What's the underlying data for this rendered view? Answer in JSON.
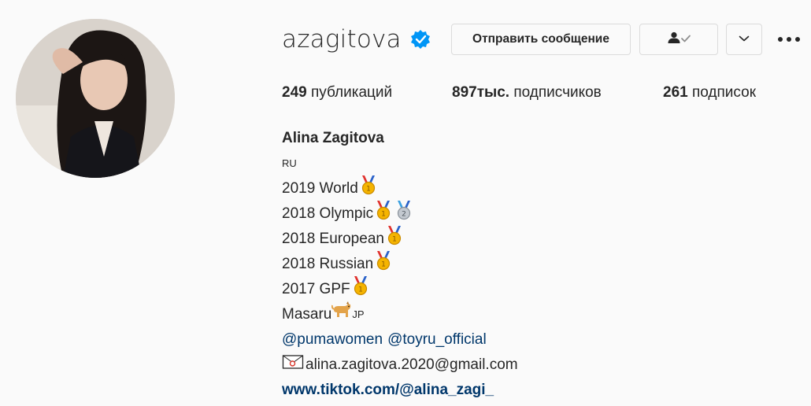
{
  "profile": {
    "username": "azagitova",
    "verified_icon": "verified-badge-icon",
    "message_button": "Отправить сообщение",
    "follow_icon": "person-check-icon",
    "suggest_icon": "chevron-down-icon",
    "more_icon": "more-dots-icon"
  },
  "stats": {
    "posts_count": "249",
    "posts_label": "публикаций",
    "followers_count": "897тыс.",
    "followers_label": "подписчиков",
    "following_count": "261",
    "following_label": "подписок"
  },
  "bio": {
    "full_name": "Alina Zagitova",
    "country_flag": "RU",
    "line_world": "2019 World",
    "line_olympic": "2018 Olympic",
    "line_european": "2018 European",
    "line_russian": "2018 Russian",
    "line_gpf": "2017 GPF",
    "line_masaru": "Masaru",
    "masaru_flag": "JP",
    "mention_1": "@pumawomen",
    "mention_2": "@toyru_official",
    "email": "alina.zagitova.2020@gmail.com",
    "website": "www.tiktok.com/@alina_zagi_"
  },
  "colors": {
    "accent_blue": "#0095f6",
    "link": "#00376b",
    "gold": "#f5b400",
    "silver": "#9aa3ad"
  }
}
